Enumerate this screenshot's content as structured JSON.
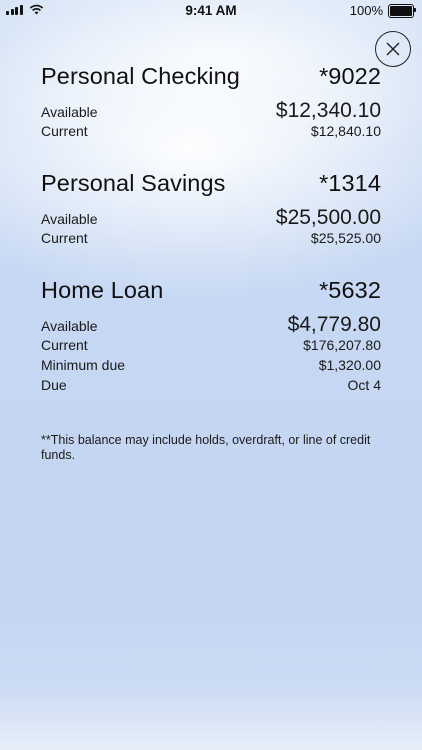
{
  "status_bar": {
    "time": "9:41 AM",
    "battery": "100%"
  },
  "accounts": [
    {
      "name": "Personal Checking",
      "number": "*9022",
      "rows": [
        {
          "label": "Available",
          "value": "$12,340.10"
        },
        {
          "label": "Current",
          "value": "$12,840.10"
        }
      ]
    },
    {
      "name": "Personal Savings",
      "number": "*1314",
      "rows": [
        {
          "label": "Available",
          "value": "$25,500.00"
        },
        {
          "label": "Current",
          "value": "$25,525.00"
        }
      ]
    },
    {
      "name": "Home Loan",
      "number": "*5632",
      "rows": [
        {
          "label": "Available",
          "value": "$4,779.80"
        },
        {
          "label": "Current",
          "value": "$176,207.80"
        },
        {
          "label": "Minimum due",
          "value": "$1,320.00"
        },
        {
          "label": "Due",
          "value": "Oct 4"
        }
      ]
    }
  ],
  "footnote": "**This balance may include holds, overdraft, or line of credit funds.",
  "icons": {
    "close": "close-icon",
    "signal": "cellular-signal-icon",
    "wifi": "wifi-icon",
    "battery": "battery-icon"
  }
}
